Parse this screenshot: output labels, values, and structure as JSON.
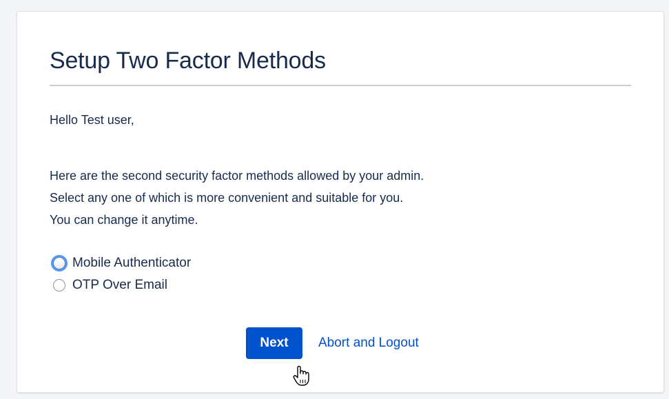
{
  "page": {
    "title": "Setup Two Factor Methods",
    "greeting": "Hello Test user,",
    "description_lines": [
      "Here are the second security factor methods allowed by your admin.",
      "Select any one of which is more convenient and suitable for you.",
      "You can change it anytime."
    ]
  },
  "methods": [
    {
      "label": "Mobile Authenticator",
      "selected": false,
      "focused": true
    },
    {
      "label": "OTP Over Email",
      "selected": false,
      "focused": false
    }
  ],
  "actions": {
    "next_label": "Next",
    "abort_label": "Abort and Logout"
  },
  "colors": {
    "primary": "#0052cc",
    "text": "#172b4d",
    "focus_ring": "#4c9aff"
  },
  "icons": {
    "cursor": "hand-pointer-icon"
  }
}
